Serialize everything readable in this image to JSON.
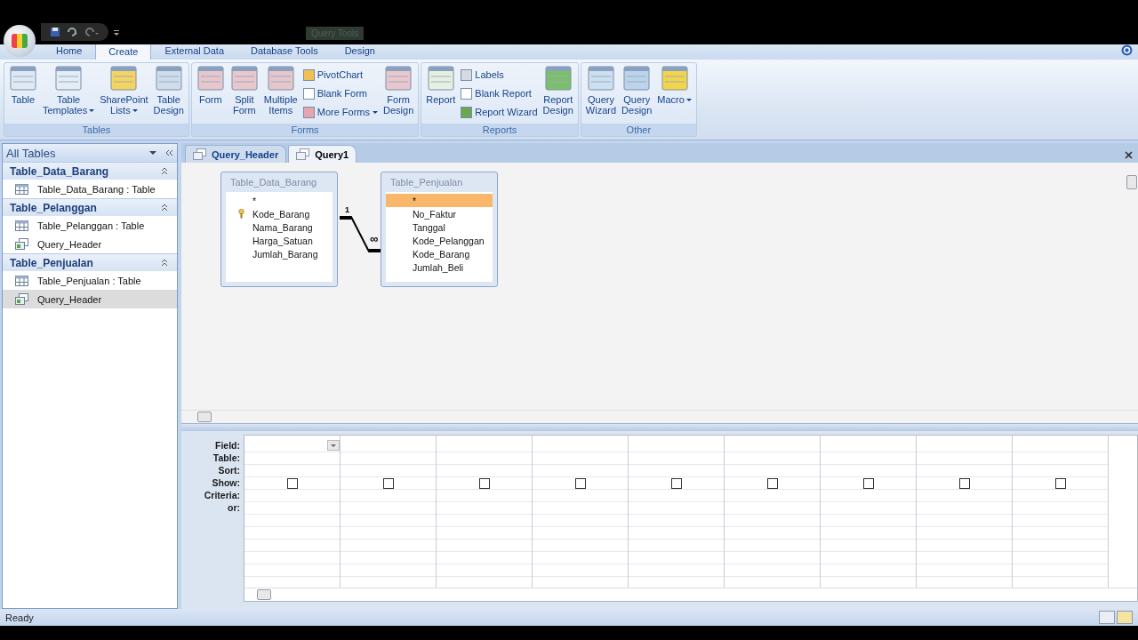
{
  "title_bar": {
    "contextual_label": "Query Tools"
  },
  "ribbon_tabs": [
    {
      "label": "Home",
      "selected": false
    },
    {
      "label": "Create",
      "selected": true
    },
    {
      "label": "External Data",
      "selected": false
    },
    {
      "label": "Database Tools",
      "selected": false
    },
    {
      "label": "Design",
      "selected": false
    }
  ],
  "ribbon_groups": [
    {
      "label": "Tables",
      "commands": [
        {
          "kind": "large",
          "lines": [
            "Table"
          ],
          "dropdown": false
        },
        {
          "kind": "large",
          "lines": [
            "Table",
            "Templates"
          ],
          "dropdown": true
        },
        {
          "kind": "large",
          "lines": [
            "SharePoint",
            "Lists"
          ],
          "dropdown": true
        },
        {
          "kind": "large",
          "lines": [
            "Table",
            "Design"
          ],
          "dropdown": false
        }
      ]
    },
    {
      "label": "Forms",
      "commands": [
        {
          "kind": "large",
          "lines": [
            "Form"
          ],
          "dropdown": false
        },
        {
          "kind": "large",
          "lines": [
            "Split",
            "Form"
          ],
          "dropdown": false
        },
        {
          "kind": "large",
          "lines": [
            "Multiple",
            "Items"
          ],
          "dropdown": false
        },
        {
          "kind": "small",
          "lines": [
            "PivotChart"
          ],
          "dropdown": false
        },
        {
          "kind": "small",
          "lines": [
            "Blank Form"
          ],
          "dropdown": false
        },
        {
          "kind": "small",
          "lines": [
            "More Forms"
          ],
          "dropdown": true
        },
        {
          "kind": "large",
          "lines": [
            "Form",
            "Design"
          ],
          "dropdown": false
        }
      ]
    },
    {
      "label": "Reports",
      "commands": [
        {
          "kind": "large",
          "lines": [
            "Report"
          ],
          "dropdown": false
        },
        {
          "kind": "small",
          "lines": [
            "Labels"
          ],
          "dropdown": false
        },
        {
          "kind": "small",
          "lines": [
            "Blank Report"
          ],
          "dropdown": false
        },
        {
          "kind": "small",
          "lines": [
            "Report Wizard"
          ],
          "dropdown": false
        },
        {
          "kind": "large",
          "lines": [
            "Report",
            "Design"
          ],
          "dropdown": false
        }
      ]
    },
    {
      "label": "Other",
      "commands": [
        {
          "kind": "large",
          "lines": [
            "Query",
            "Wizard"
          ],
          "dropdown": false
        },
        {
          "kind": "large",
          "lines": [
            "Query",
            "Design"
          ],
          "dropdown": false
        },
        {
          "kind": "large",
          "lines": [
            "Macro"
          ],
          "dropdown": true
        }
      ]
    }
  ],
  "nav_pane": {
    "title": "All Tables",
    "groups": [
      {
        "title": "Table_Data_Barang",
        "expanded": true,
        "items": [
          {
            "label": "Table_Data_Barang : Table",
            "kind": "table",
            "selected": false
          }
        ]
      },
      {
        "title": "Table_Pelanggan",
        "expanded": true,
        "items": [
          {
            "label": "Table_Pelanggan : Table",
            "kind": "table",
            "selected": false
          },
          {
            "label": "Query_Header",
            "kind": "query",
            "selected": false
          }
        ]
      },
      {
        "title": "Table_Penjualan",
        "expanded": true,
        "items": [
          {
            "label": "Table_Penjualan : Table",
            "kind": "table",
            "selected": false
          },
          {
            "label": "Query_Header",
            "kind": "query",
            "selected": true
          }
        ]
      }
    ]
  },
  "doc_tabs": [
    {
      "label": "Query_Header",
      "selected": false
    },
    {
      "label": "Query1",
      "selected": true
    }
  ],
  "tables": [
    {
      "title": "Table_Data_Barang",
      "fields": [
        {
          "name": "*",
          "key": false,
          "selected": false
        },
        {
          "name": "Kode_Barang",
          "key": true,
          "selected": false
        },
        {
          "name": "Nama_Barang",
          "key": false,
          "selected": false
        },
        {
          "name": "Harga_Satuan",
          "key": false,
          "selected": false
        },
        {
          "name": "Jumlah_Barang",
          "key": false,
          "selected": false
        }
      ]
    },
    {
      "title": "Table_Penjualan",
      "fields": [
        {
          "name": "*",
          "key": false,
          "selected": true
        },
        {
          "name": "No_Faktur",
          "key": false,
          "selected": false
        },
        {
          "name": "Tanggal",
          "key": false,
          "selected": false
        },
        {
          "name": "Kode_Pelanggan",
          "key": false,
          "selected": false
        },
        {
          "name": "Kode_Barang",
          "key": false,
          "selected": false
        },
        {
          "name": "Jumlah_Beli",
          "key": false,
          "selected": false
        }
      ]
    }
  ],
  "relationship": {
    "one_label": "1",
    "many_label": "∞"
  },
  "grid": {
    "row_labels": [
      "Field:",
      "Table:",
      "Sort:",
      "Show:",
      "Criteria:",
      "or:"
    ],
    "columns": [
      {
        "show": false
      },
      {
        "show": false
      },
      {
        "show": false
      },
      {
        "show": false
      },
      {
        "show": false
      },
      {
        "show": false
      },
      {
        "show": false
      },
      {
        "show": false
      },
      {
        "show": false
      }
    ]
  },
  "status_bar": {
    "text": "Ready"
  }
}
